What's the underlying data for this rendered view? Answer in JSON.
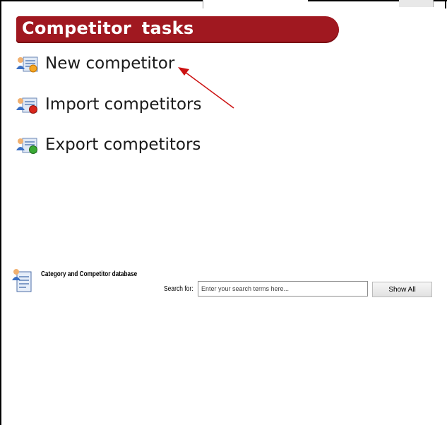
{
  "tasks_panel": {
    "title": "Competitor tasks",
    "accent_color": "#a01820",
    "items": [
      {
        "label": "New competitor",
        "icon": "new-competitor-icon"
      },
      {
        "label": "Import competitors",
        "icon": "import-competitors-icon"
      },
      {
        "label": "Export competitors",
        "icon": "export-competitors-icon"
      }
    ]
  },
  "annotation": {
    "color": "#cc1111",
    "points_to": "New competitor"
  },
  "database": {
    "title": "Category and Competitor database",
    "icon": "database-document-icon",
    "search_label": "Search for:",
    "search_placeholder": "Enter your search terms here...",
    "search_value": "",
    "show_all_label": "Show All"
  }
}
